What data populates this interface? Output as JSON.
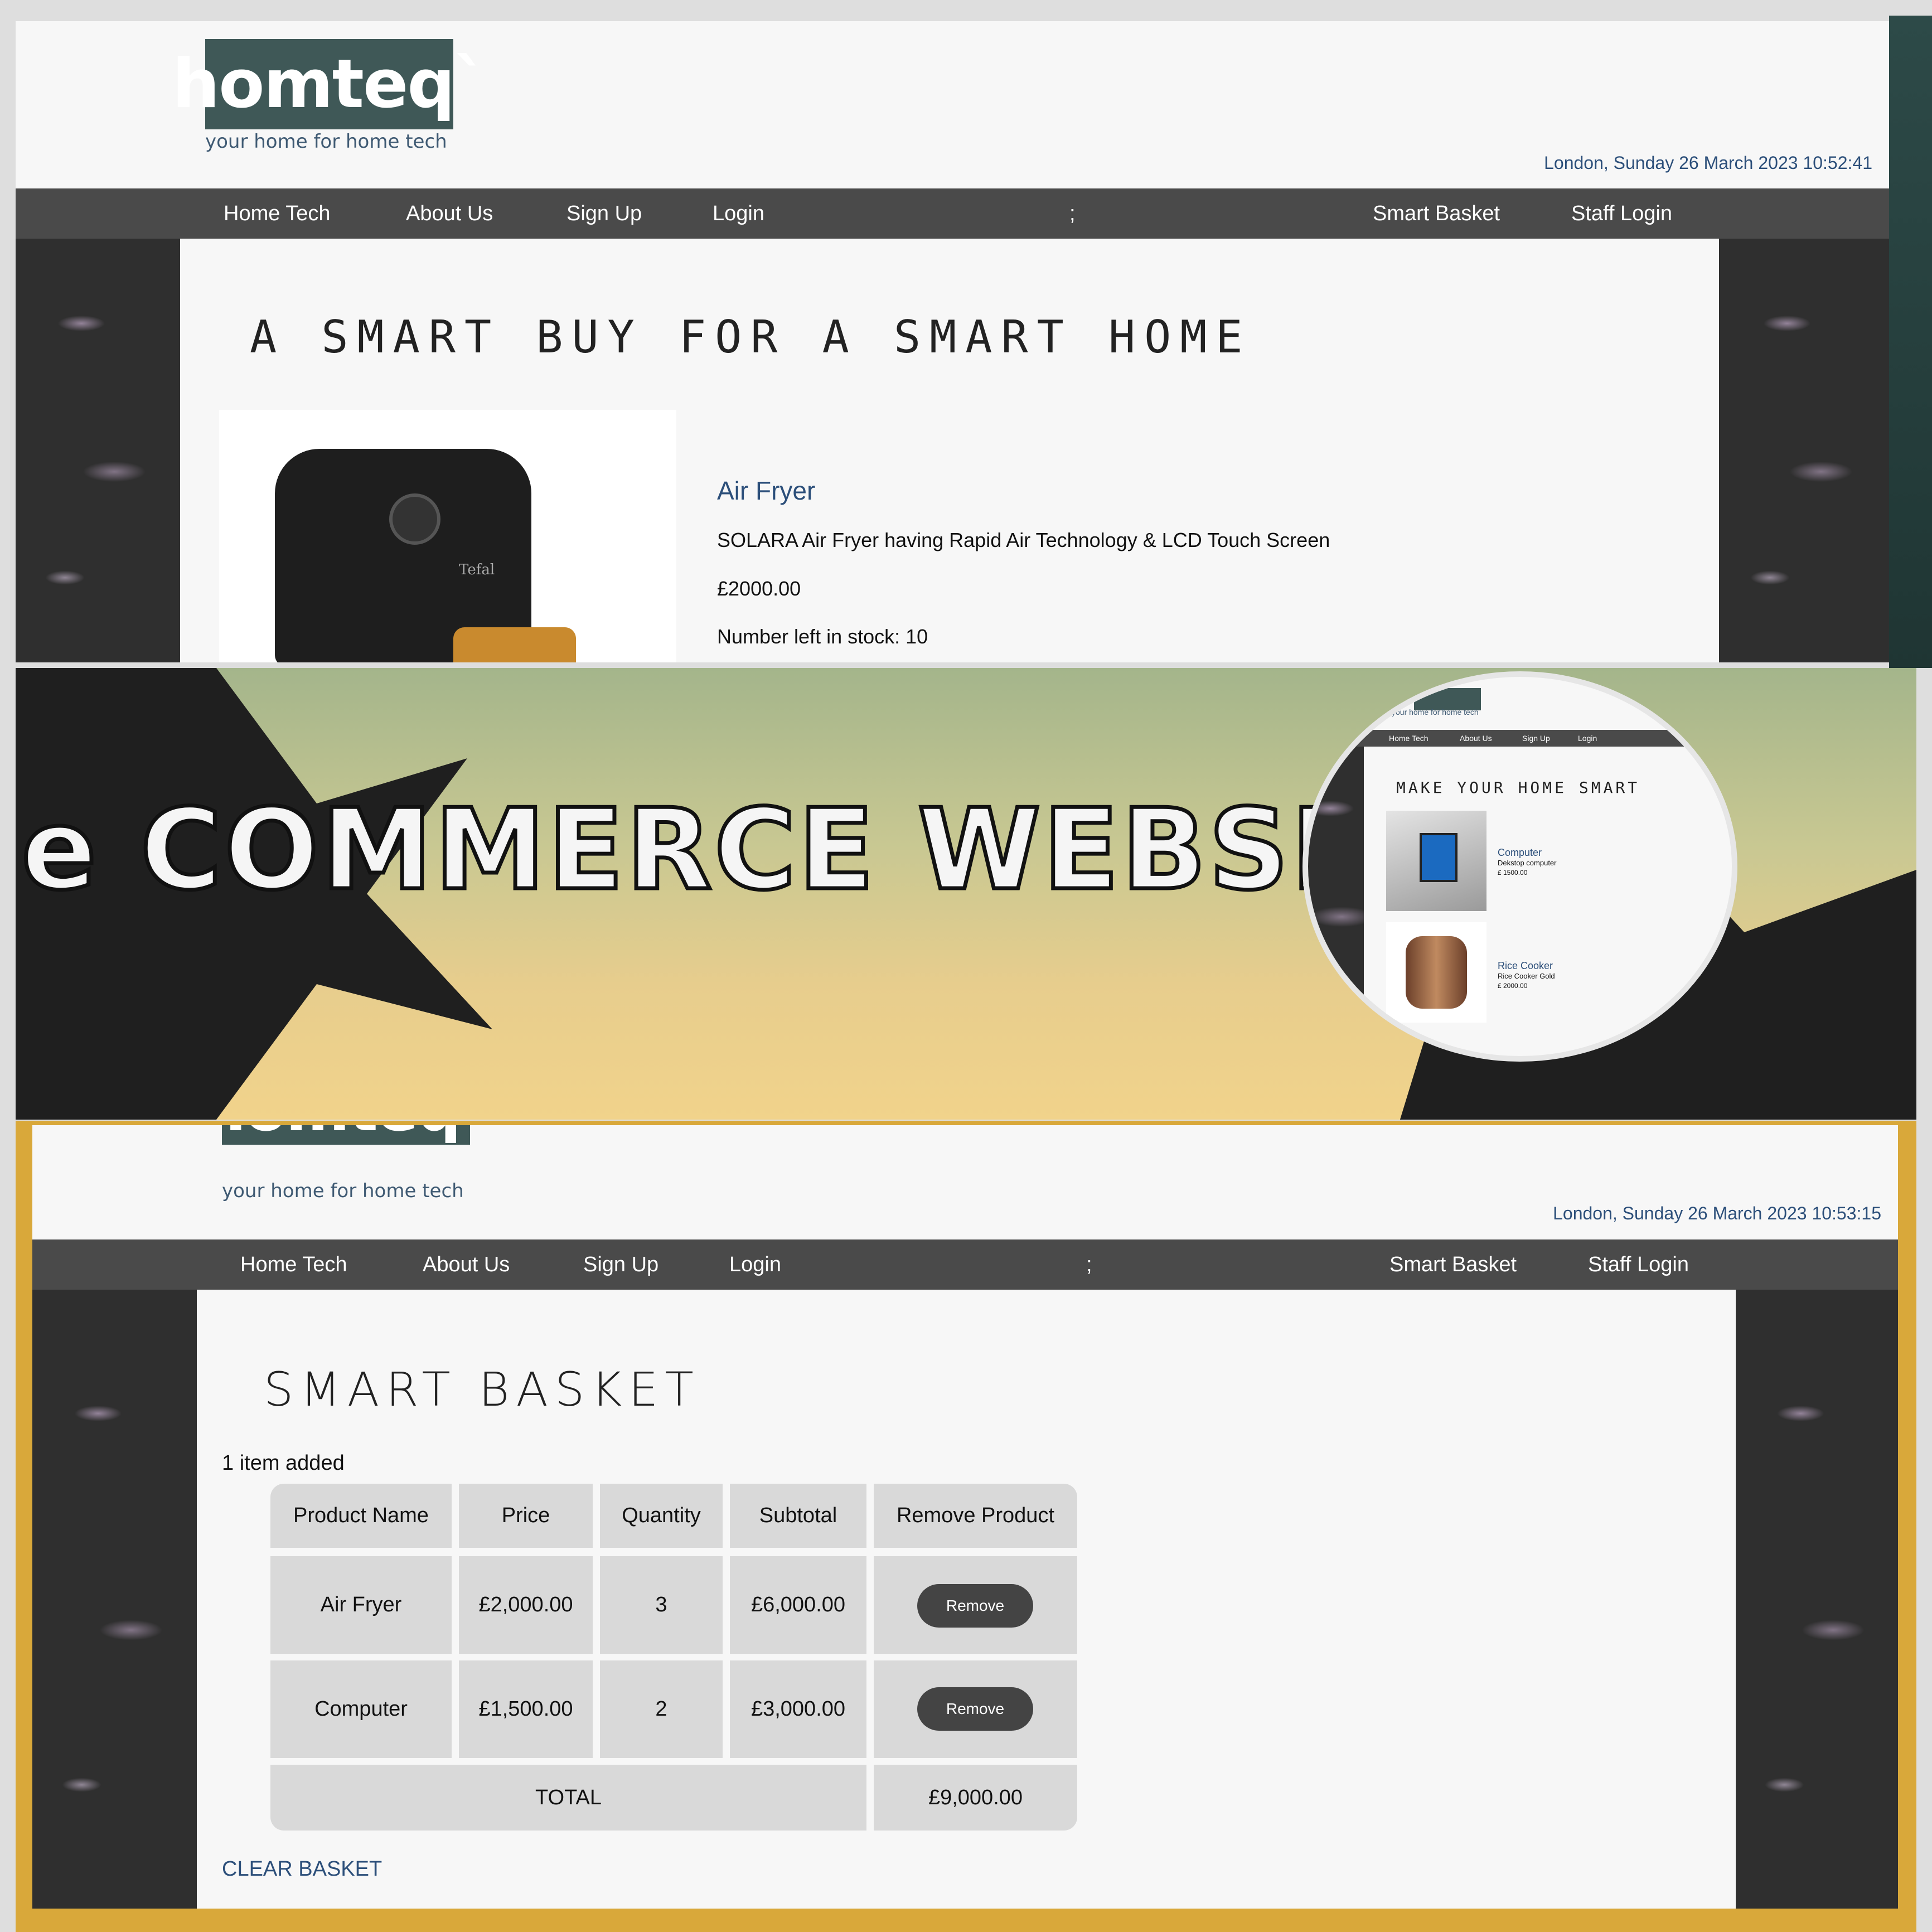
{
  "brand": {
    "logo_text": "homteq`",
    "tagline": "your home for home tech"
  },
  "nav": {
    "home_tech": "Home Tech",
    "about_us": "About Us",
    "sign_up": "Sign Up",
    "login": "Login",
    "separator": ";",
    "smart_basket": "Smart Basket",
    "staff_login": "Staff Login"
  },
  "top_page": {
    "datetime": "London, Sunday 26 March 2023 10:52:41",
    "heading": "A SMART BUY FOR A SMART HOME",
    "product": {
      "name": "Air Fryer",
      "description": "SOLARA Air Fryer having Rapid Air Technology & LCD Touch Screen",
      "price": "£2000.00",
      "stock": "Number left in stock: 10",
      "brand_mark": "Tefal"
    }
  },
  "banner": {
    "title": "e COMMERCE WEBSITE"
  },
  "inset": {
    "logo_fragment": "homteq`",
    "tagline": "your home for home tech",
    "nav": [
      "Home Tech",
      "About Us",
      "Sign Up",
      "Login"
    ],
    "heading": "MAKE YOUR HOME SMART",
    "products": [
      {
        "name": "Computer",
        "description": "Dekstop computer",
        "price": "£ 1500.00"
      },
      {
        "name": "Rice Cooker",
        "description": "Rice Cooker Gold",
        "price": "£ 2000.00"
      }
    ]
  },
  "basket_page": {
    "datetime": "London, Sunday 26 March 2023 10:53:15",
    "heading": "SMART BASKET",
    "items_added": "1 item added",
    "columns": [
      "Product Name",
      "Price",
      "Quantity",
      "Subtotal",
      "Remove Product"
    ],
    "rows": [
      {
        "name": "Air Fryer",
        "price": "£2,000.00",
        "quantity": "3",
        "subtotal": "£6,000.00",
        "action": "Remove"
      },
      {
        "name": "Computer",
        "price": "£1,500.00",
        "quantity": "2",
        "subtotal": "£3,000.00",
        "action": "Remove"
      }
    ],
    "total_label": "TOTAL",
    "total_value": "£9,000.00",
    "clear_basket": "CLEAR BASKET"
  },
  "colors": {
    "brand": "#3f5857",
    "nav": "#4a4a4a",
    "link": "#2c4f7a",
    "table_cell": "#d9d9d9"
  }
}
